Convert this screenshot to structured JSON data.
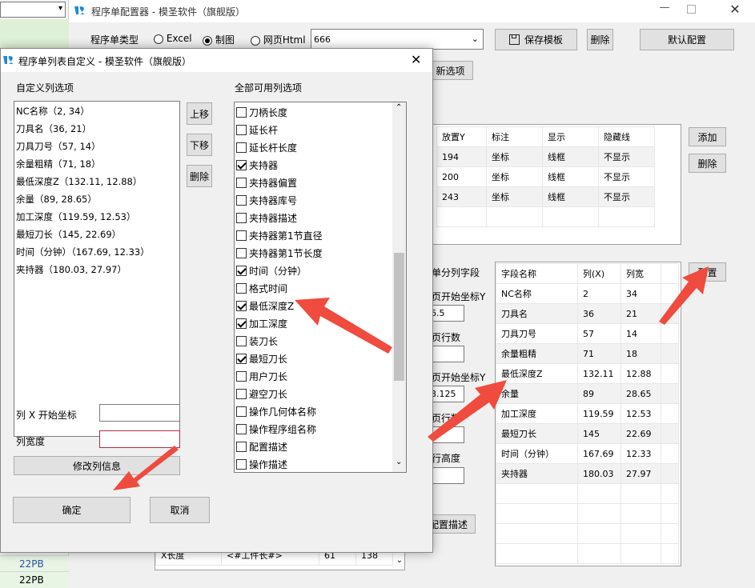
{
  "bg_window": {
    "title": "程序单配置器 - 模圣软件（旗舰版）",
    "type_label": "程序单类型",
    "radios": [
      {
        "label": "Excel",
        "checked": false
      },
      {
        "label": "制图",
        "checked": true
      },
      {
        "label": "网页Html",
        "checked": false
      }
    ],
    "template_value": "666",
    "save_btn": "保存模板",
    "delete_btn": "删除",
    "default_btn": "默认配置",
    "new_option_btn": "新选项",
    "table1": {
      "headers": [
        "放置Y",
        "标注",
        "显示",
        "隐藏线"
      ],
      "rows": [
        [
          "194",
          "坐标",
          "线框",
          "不显示"
        ],
        [
          "200",
          "坐标",
          "线框",
          "不显示"
        ],
        [
          "243",
          "坐标",
          "线框",
          "不显示"
        ]
      ]
    },
    "add_btn": "添加",
    "delete_btn2": "删除",
    "left_labels": [
      "单分列字段",
      "页开始坐标Y",
      "页行数",
      "页开始坐标Y",
      "页行数",
      "行高度"
    ],
    "left_values": [
      "6.5",
      "",
      "3.125",
      ""
    ],
    "config_desc_btn": "配置描述",
    "field_table": {
      "headers": [
        "字段名称",
        "列(X)",
        "列宽"
      ],
      "rows": [
        [
          "NC名称",
          "2",
          "34"
        ],
        [
          "刀具名",
          "36",
          "21"
        ],
        [
          "刀具刀号",
          "57",
          "14"
        ],
        [
          "余量粗精",
          "71",
          "18"
        ],
        [
          "最低深度Z",
          "132.11",
          "12.88"
        ],
        [
          "余量",
          "89",
          "28.65"
        ],
        [
          "加工深度",
          "119.59",
          "12.53"
        ],
        [
          "最短刀长",
          "145",
          "22.69"
        ],
        [
          "时间（分钟）",
          "167.69",
          "12.33"
        ],
        [
          "夹持器",
          "180.03",
          "27.97"
        ]
      ]
    },
    "config_btn": "配置",
    "bottom_row": [
      "X长度",
      "<#工件长#>",
      "61",
      "138"
    ],
    "side_items": [
      "22PB",
      "22PB"
    ]
  },
  "dialog": {
    "title": "程序单列表自定义 - 模圣软件（旗舰版）",
    "custom_cols_label": "自定义列选项",
    "all_cols_label": "全部可用列选项",
    "custom_items": [
      "NC名称（2, 34）",
      "刀具名（36, 21）",
      "刀具刀号（57, 14）",
      "余量粗精（71, 18）",
      "最低深度Z（132.11, 12.88）",
      "余量（89, 28.65）",
      "加工深度（119.59, 12.53）",
      "最短刀长（145, 22.69）",
      "时间（分钟）（167.69, 12.33）",
      "夹持器（180.03, 27.97）"
    ],
    "up_btn": "上移",
    "down_btn": "下移",
    "delete_btn": "删除",
    "all_items": [
      {
        "label": "刀柄长度",
        "checked": false
      },
      {
        "label": "延长杆",
        "checked": false
      },
      {
        "label": "延长杆长度",
        "checked": false
      },
      {
        "label": "夹持器",
        "checked": true
      },
      {
        "label": "夹持器偏置",
        "checked": false
      },
      {
        "label": "夹持器库号",
        "checked": false
      },
      {
        "label": "夹持器描述",
        "checked": false
      },
      {
        "label": "夹持器第1节直径",
        "checked": false
      },
      {
        "label": "夹持器第1节长度",
        "checked": false
      },
      {
        "label": "时间（分钟）",
        "checked": true
      },
      {
        "label": "格式时间",
        "checked": false
      },
      {
        "label": "最低深度Z",
        "checked": true
      },
      {
        "label": "加工深度",
        "checked": true
      },
      {
        "label": "装刀长",
        "checked": false
      },
      {
        "label": "最短刀长",
        "checked": true
      },
      {
        "label": "用户刀长",
        "checked": false
      },
      {
        "label": "避空刀长",
        "checked": false
      },
      {
        "label": "操作几何体名称",
        "checked": false
      },
      {
        "label": "操作程序组名称",
        "checked": false
      },
      {
        "label": "配置描述",
        "checked": false
      },
      {
        "label": "操作描述",
        "checked": false
      }
    ],
    "x_start_label": "列 X 开始坐标",
    "x_start_value": "",
    "col_width_label": "列宽度",
    "col_width_value": "",
    "modify_btn": "修改列信息",
    "ok_btn": "确定",
    "cancel_btn": "取消"
  },
  "colors": {
    "arrow": "#ef4b3e",
    "window_bg": "#f0f0f0",
    "logo": "#1e88d8"
  }
}
